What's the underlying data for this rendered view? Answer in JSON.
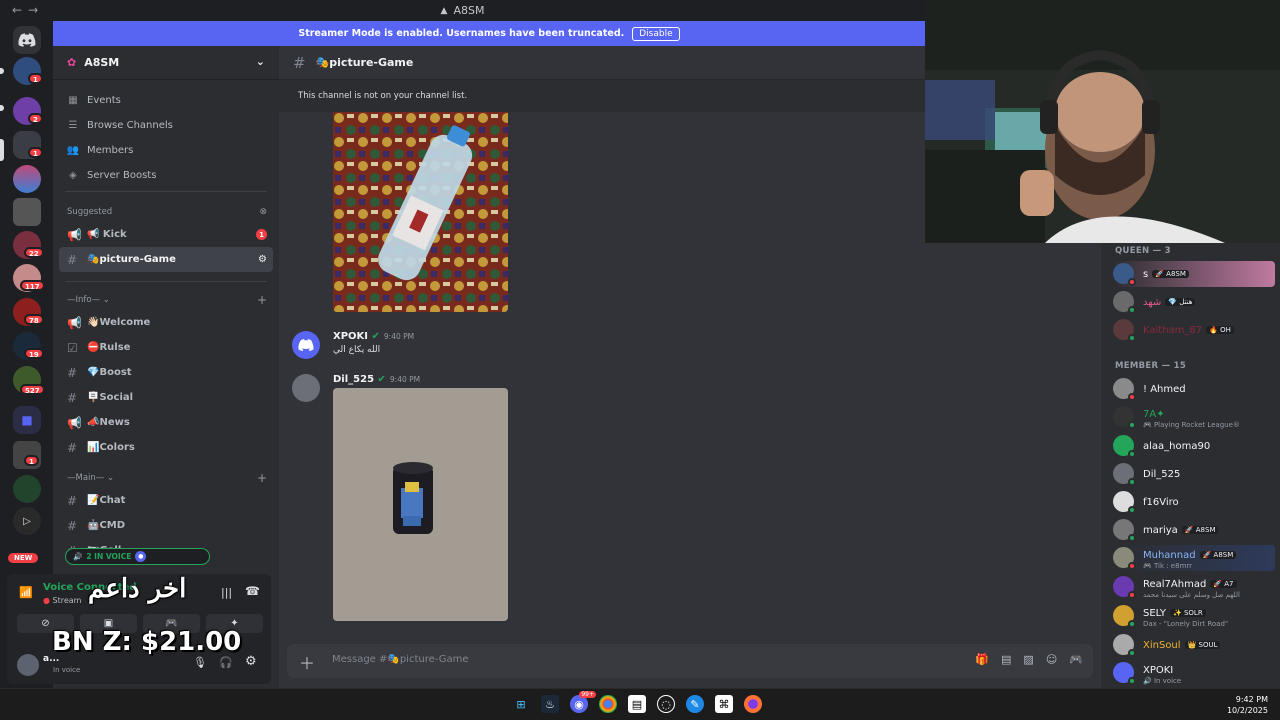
{
  "window": {
    "title": "A8SM",
    "nav_back": "←",
    "nav_fwd": "→"
  },
  "banner": {
    "text": "Streamer Mode is enabled. Usernames have been truncated.",
    "button": "Disable"
  },
  "servers": {
    "badges": [
      "1",
      "2",
      "1",
      "22",
      "117",
      "78",
      "19",
      "527",
      "1"
    ],
    "new_label": "NEW"
  },
  "sidebar": {
    "server_name": "A8SM",
    "nav": [
      {
        "label": "Events",
        "icon": "calendar-icon"
      },
      {
        "label": "Browse Channels",
        "icon": "list-icon"
      },
      {
        "label": "Members",
        "icon": "people-icon"
      },
      {
        "label": "Server Boosts",
        "icon": "boost-icon"
      }
    ],
    "suggested_label": "Suggested",
    "suggested": [
      {
        "name": "📢 Kick",
        "badge": "1",
        "type": "announce"
      },
      {
        "name": "🎭picture-Game",
        "type": "text"
      }
    ],
    "info_label": "—Info— ⌄",
    "info_channels": [
      {
        "name": "👋🏻Welcome",
        "type": "announce"
      },
      {
        "name": "⛔Rulse",
        "type": "rules"
      },
      {
        "name": "💎Boost",
        "type": "text"
      },
      {
        "name": "🪧Social",
        "type": "text"
      },
      {
        "name": "📣News",
        "type": "announce"
      },
      {
        "name": "📊Colors",
        "type": "text"
      }
    ],
    "main_label": "—Main— ⌄",
    "main_channels": [
      {
        "name": "📝Chat"
      },
      {
        "name": "🤖CMD"
      },
      {
        "name": "📷Gall"
      }
    ],
    "voice_pill": "2 IN VOICE"
  },
  "voice": {
    "title": "Voice Connected",
    "sub": "Stream",
    "user": "a...",
    "status": "In voice"
  },
  "overlay": {
    "line1": "اخر داعم",
    "line2": "BN Z: $21.00"
  },
  "chat": {
    "channel": "🎭picture-Game",
    "notice": "This channel is not on your channel list.",
    "messages": [
      {
        "user": "XPOKI",
        "time": "9:40 PM",
        "text": "الله يكاع الي"
      },
      {
        "user": "Dil_525",
        "time": "9:40 PM"
      }
    ],
    "placeholder": "Message #🎭picture-Game"
  },
  "members": {
    "group1": "QUEEN — 3",
    "queen": [
      {
        "name": "s",
        "tag": "🚀 A8SM"
      },
      {
        "name": "شهد",
        "tag": "💎 هنتل"
      },
      {
        "name": "Kaltham_87",
        "tag": "🔥 OH"
      }
    ],
    "group2": "MEMBER — 15",
    "list": [
      {
        "name": "! Ahmed",
        "sub": ""
      },
      {
        "name": "7A✦",
        "sub": "🎮 Playing Rocket League®"
      },
      {
        "name": "alaa_homa90",
        "sub": ""
      },
      {
        "name": "Dil_525",
        "sub": ""
      },
      {
        "name": "f16Viro",
        "sub": ""
      },
      {
        "name": "mariya",
        "tag": "🚀 A8SM",
        "sub": ""
      },
      {
        "name": "Muhannad",
        "tag": "🚀 A8SM",
        "sub": "🎮 Tik : e8mrr"
      },
      {
        "name": "Real7Ahmad",
        "tag": "🚀 A7",
        "sub": "اللهم صل وسلم على سيدنا محمد"
      },
      {
        "name": "SELY",
        "tag": "✨ SOLR",
        "sub": "Dax - \"Lonely Dirt Road\""
      },
      {
        "name": "XinSoul",
        "tag": "👑 SOUL",
        "sub": ""
      },
      {
        "name": "XPOKI",
        "sub": "🔊 In voice"
      }
    ]
  },
  "taskbar": {
    "time": "9:42 PM",
    "date": "10/2/2025",
    "chrome_badge": "99+"
  },
  "colors": {
    "accent": "#5865f2",
    "green": "#23a55a",
    "red": "#f23f43"
  }
}
